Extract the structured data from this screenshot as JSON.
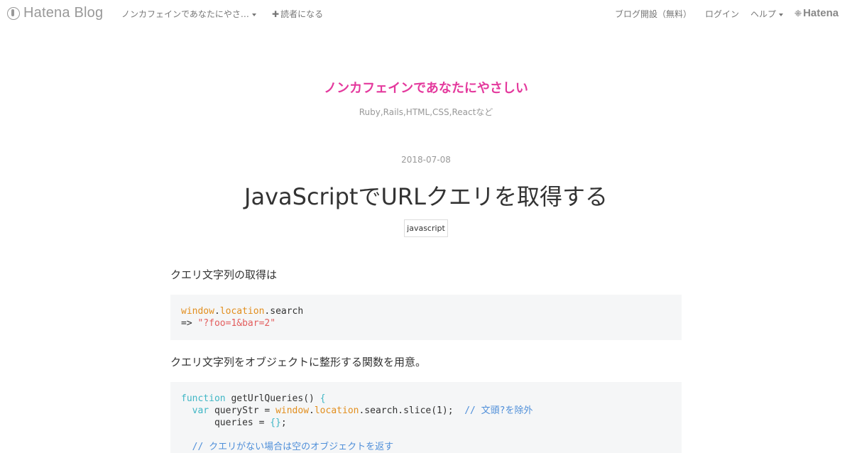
{
  "topbar": {
    "logo_text": "Hatena Blog",
    "blog_name": "ノンカフェインであなたにやさ…",
    "subscribe_label": "読者になる",
    "open_blog_label": "ブログ開設（無料）",
    "login_label": "ログイン",
    "help_label": "ヘルプ",
    "hatena_label": "Hatena"
  },
  "blog": {
    "title": "ノンカフェインであなたにやさしい",
    "description": "Ruby,Rails,HTML,CSS,Reactなど"
  },
  "entry": {
    "date": "2018-07-08",
    "title": "JavaScriptでURLクエリを取得する",
    "category": "javascript",
    "paragraph_1": "クエリ文字列の取得は",
    "paragraph_2": "クエリ文字列をオブジェクトに整形する関数を用意。",
    "code_1": {
      "l1_obj1": "window",
      "l1_dot1": ".",
      "l1_obj2": "location",
      "l1_rest": ".search",
      "l2_arrow": "=> ",
      "l2_str": "\"?foo=1&bar=2\""
    },
    "code_2": {
      "l1_kw": "function",
      "l1_rest": " getUrlQueries() ",
      "l1_brace": "{",
      "l2_indent": "  ",
      "l2_kw": "var",
      "l2_a": " queryStr = ",
      "l2_obj1": "window",
      "l2_dot": ".",
      "l2_obj2": "location",
      "l2_b": ".search.slice(1);  ",
      "l2_cmt": "// 文頭?を除外",
      "l3_a": "      queries = ",
      "l3_brace": "{}",
      "l3_b": ";",
      "l4_blank": "",
      "l5_cmt": "  // クエリがない場合は空のオブジェクトを返す"
    }
  },
  "colors": {
    "blog_title": "#e4399d",
    "keyword": "#3fb6c5",
    "object": "#e28e1d",
    "string": "#e35d5d",
    "comment": "#4f8fd9",
    "code_bg": "#f5f6f7"
  },
  "icons": {
    "logo": "hatena-blog-logo-icon",
    "caret": "caret-down-icon",
    "plus": "plus-icon"
  }
}
